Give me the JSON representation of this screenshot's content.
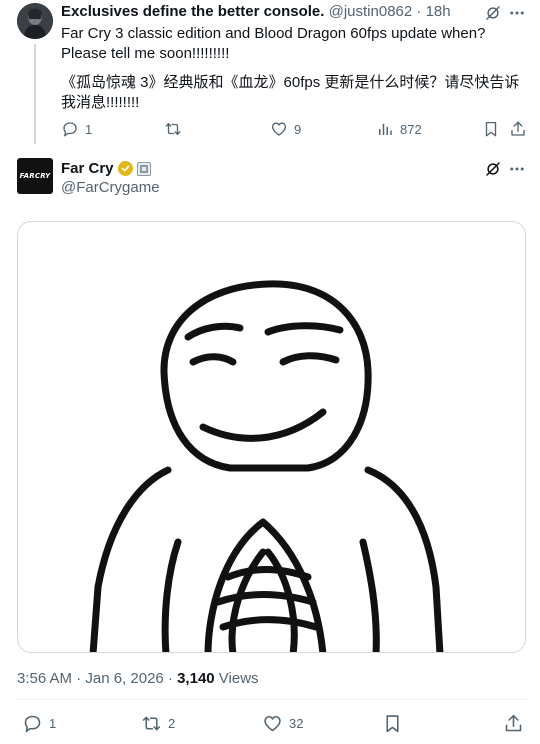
{
  "reply": {
    "display_name": "Exclusives define the better console.",
    "handle": "@justin0862",
    "separator": "·",
    "time": "18h",
    "text_line1": "Far Cry 3 classic edition and Blood Dragon 60fps update when? Please tell me soon!!!!!!!!!",
    "text_line2": "《孤岛惊魂 3》经典版和《血龙》60fps 更新是什么时候？请尽快告诉我消息!!!!!!!!",
    "stats": {
      "replies": "1",
      "reposts": "",
      "likes": "9",
      "views": "872"
    }
  },
  "main": {
    "display_name": "Far Cry",
    "handle": "@FarCrygame",
    "avatar_text": "FARCRY",
    "timestamp": "3:56 AM · Jan 6, 2026 · ",
    "views_count": "3,140",
    "views_label": " Views",
    "stats": {
      "replies": "1",
      "reposts": "2",
      "likes": "32"
    }
  },
  "colors": {
    "text": "#0f1419",
    "muted": "#536471",
    "border": "#cfd9de",
    "verified_gold": "#e2b719"
  },
  "icons": [
    "reply-icon",
    "repost-icon",
    "like-icon",
    "views-icon",
    "bookmark-icon",
    "share-icon",
    "grok-icon",
    "more-icon",
    "verified-badge-icon",
    "affiliate-badge-icon"
  ]
}
